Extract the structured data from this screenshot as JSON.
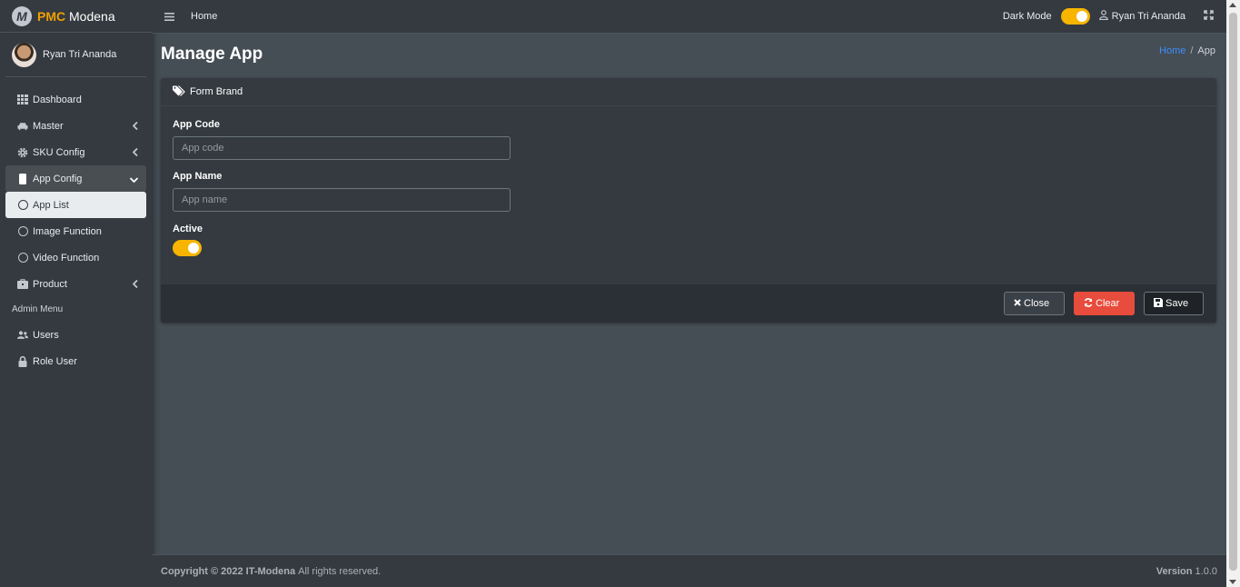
{
  "brand": {
    "bold": "PMC",
    "name": "Modena",
    "logo_letter": "M"
  },
  "sidebar": {
    "user_name": "Ryan Tri Ananda",
    "items": [
      {
        "label": "Dashboard",
        "icon": "grid-icon"
      },
      {
        "label": "Master",
        "icon": "car-icon"
      },
      {
        "label": "SKU Config",
        "icon": "gear-icon"
      },
      {
        "label": "App Config",
        "icon": "mobile-icon"
      },
      {
        "label": "App List",
        "icon": "circle-icon"
      },
      {
        "label": "Image Function",
        "icon": "circle-icon"
      },
      {
        "label": "Video Function",
        "icon": "circle-icon"
      },
      {
        "label": "Product",
        "icon": "briefcase-icon"
      }
    ],
    "admin_header": "Admin Menu",
    "admin_items": [
      {
        "label": "Users",
        "icon": "users-icon"
      },
      {
        "label": "Role User",
        "icon": "lock-icon"
      }
    ]
  },
  "navbar": {
    "home": "Home",
    "dark_mode_label": "Dark Mode",
    "user_name": "Ryan Tri Ananda"
  },
  "page": {
    "title": "Manage App",
    "breadcrumb": {
      "home": "Home",
      "separator": "/",
      "current": "App"
    }
  },
  "form": {
    "header": "Form Brand",
    "app_code_label": "App Code",
    "app_code_placeholder": "App code",
    "app_name_label": "App Name",
    "app_name_placeholder": "App name",
    "active_label": "Active",
    "close_label": "Close",
    "clear_label": "Clear",
    "save_label": "Save"
  },
  "footer": {
    "copyright_bold": "Copyright © 2022 IT-Modena",
    "copyright_rest": "All rights reserved.",
    "version_label": "Version",
    "version_number": "1.0.0"
  },
  "colors": {
    "accent": "#f7b500",
    "danger": "#e74c3c",
    "link": "#3f8efc",
    "sidebar_bg": "#343a40",
    "content_bg": "#454d55"
  }
}
